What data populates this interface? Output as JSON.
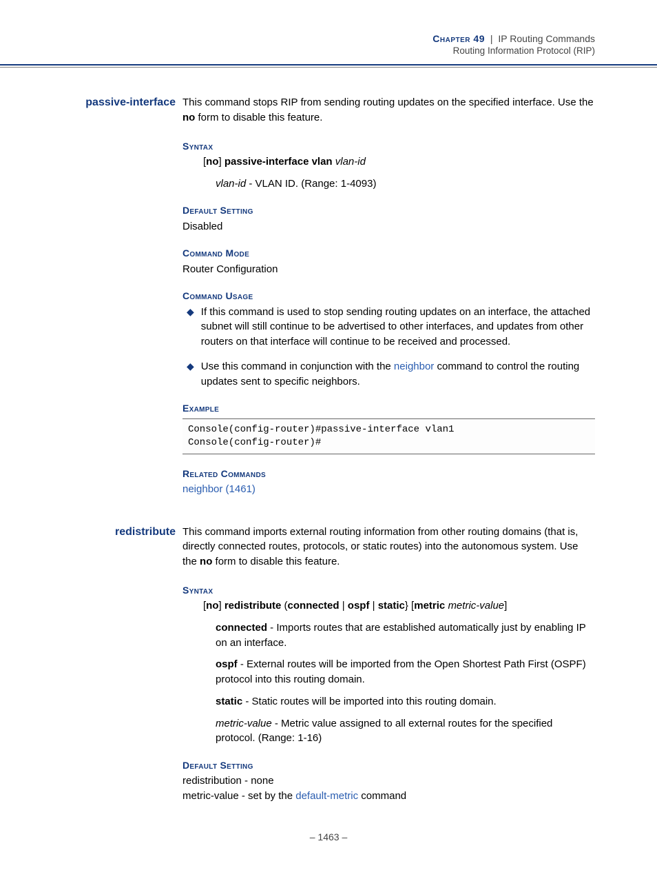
{
  "header": {
    "chapter_label": "Chapter 49",
    "sep": "|",
    "chapter_title": "IP Routing Commands",
    "sub": "Routing Information Protocol (RIP)"
  },
  "passive": {
    "label": "passive-interface",
    "intro_pre": "This command stops RIP from sending routing updates on the specified interface. Use the ",
    "intro_bold": "no",
    "intro_post": " form to disable this feature.",
    "syntax_hdr": "Syntax",
    "syntax_br_open": "[",
    "syntax_no": "no",
    "syntax_br_close": "] ",
    "syntax_cmd": "passive-interface vlan",
    "syntax_arg": " vlan-id",
    "param_name": "vlan-id",
    "param_desc": " - VLAN ID. (Range: 1-4093)",
    "default_hdr": "Default Setting",
    "default_val": "Disabled",
    "mode_hdr": "Command Mode",
    "mode_val": "Router Configuration",
    "usage_hdr": "Command Usage",
    "usage1": "If this command is used to stop sending routing updates on an interface, the attached subnet will still continue to be advertised to other interfaces, and updates from other routers on that interface will continue to be received and processed.",
    "usage2_pre": "Use this command in conjunction with the ",
    "usage2_link": "neighbor",
    "usage2_post": " command to control the routing updates sent to specific neighbors.",
    "example_hdr": "Example",
    "code": "Console(config-router)#passive-interface vlan1\nConsole(config-router)#",
    "related_hdr": "Related Commands",
    "related_link": "neighbor (1461)"
  },
  "redist": {
    "label": "redistribute",
    "intro_pre": "This command imports external routing information from other routing domains (that is, directly connected routes, protocols, or static routes) into the autonomous system. Use the ",
    "intro_bold": "no",
    "intro_post": " form to disable this feature.",
    "syntax_hdr": "Syntax",
    "s_br_open": "[",
    "s_no": "no",
    "s_br_close": "] ",
    "s_cmd": "redistribute",
    "s_paren_open": " (",
    "s_connected": "connected",
    "s_pipe1": " | ",
    "s_ospf": "ospf",
    "s_pipe2": " | ",
    "s_static": "static",
    "s_close_set": "} [",
    "s_metric": "metric",
    "s_space": " ",
    "s_metric_val": "metric-value",
    "s_end": "]",
    "p1_b": "connected",
    "p1_t": " - Imports routes that are established automatically just by enabling IP on an interface.",
    "p2_b": "ospf",
    "p2_t": " - External routes will be imported from the Open Shortest Path First (OSPF) protocol into this routing domain.",
    "p3_b": "static",
    "p3_t": " - Static routes will be imported into this routing domain.",
    "p4_i": "metric-value",
    "p4_t": " - Metric value assigned to all external routes for the specified protocol. (Range: 1-16)",
    "default_hdr": "Default Setting",
    "d1": "redistribution - none",
    "d2_pre": "metric-value - set by the ",
    "d2_link": "default-metric",
    "d2_post": " command"
  },
  "footer": {
    "page": "–  1463  –"
  }
}
